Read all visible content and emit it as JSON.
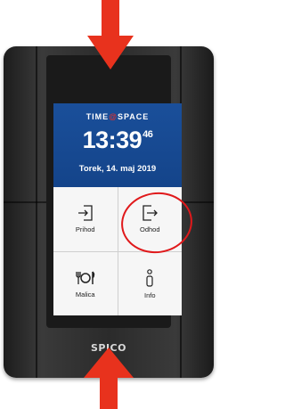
{
  "brand": {
    "left": "TIME",
    "right": "SPACE"
  },
  "clock": {
    "time": "13:39",
    "seconds": "46",
    "date": "Torek, 14. maj 2019"
  },
  "tiles": [
    {
      "label": "Prihod",
      "icon": "arrive-icon"
    },
    {
      "label": "Odhod",
      "icon": "leave-icon"
    },
    {
      "label": "Malica",
      "icon": "meal-icon"
    },
    {
      "label": "Info",
      "icon": "info-icon"
    }
  ],
  "device_logo": "SPICO",
  "colors": {
    "header_blue": "#1a4f9a",
    "annotation_red": "#e0191b",
    "arrow_red": "#e8321d"
  }
}
